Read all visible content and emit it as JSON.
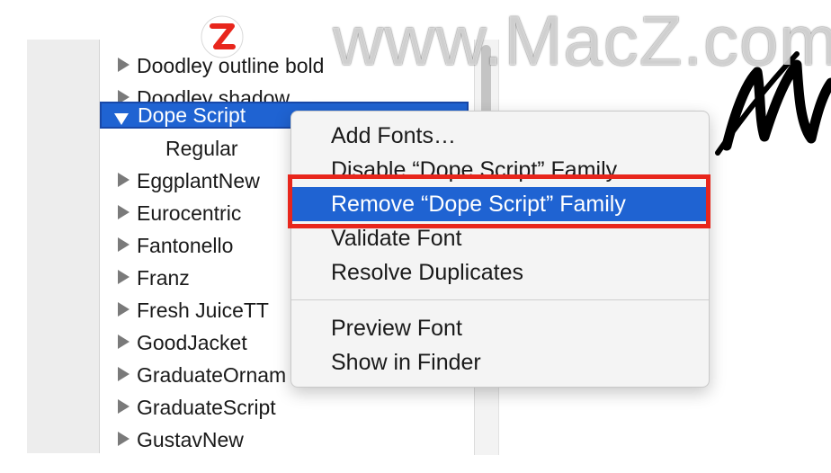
{
  "font_list": {
    "rows": [
      {
        "label": "Doodley outline bold",
        "type": "collapsed"
      },
      {
        "label": "Doodley shadow",
        "type": "collapsed"
      },
      {
        "label": "Dope Script",
        "type": "expanded-selected"
      },
      {
        "label": "Regular",
        "type": "child"
      },
      {
        "label": "EggplantNew",
        "type": "collapsed"
      },
      {
        "label": "Eurocentric",
        "type": "collapsed"
      },
      {
        "label": "Fantonello",
        "type": "collapsed"
      },
      {
        "label": "Franz",
        "type": "collapsed"
      },
      {
        "label": "Fresh JuiceTT",
        "type": "collapsed"
      },
      {
        "label": "GoodJacket",
        "type": "collapsed"
      },
      {
        "label": "GraduateOrnam",
        "type": "collapsed"
      },
      {
        "label": "GraduateScript",
        "type": "collapsed"
      },
      {
        "label": "GustavNew",
        "type": "collapsed"
      }
    ]
  },
  "context_menu": {
    "items": [
      {
        "label": "Add Fonts…"
      },
      {
        "label": "Disable “Dope Script” Family"
      },
      {
        "label": "Remove “Dope Script” Family",
        "highlighted": true
      },
      {
        "label": "Validate Font"
      },
      {
        "label": "Resolve Duplicates"
      },
      {
        "label": "Preview Font"
      },
      {
        "label": "Show in Finder"
      }
    ]
  },
  "watermark": {
    "text": "www.MacZ.com"
  },
  "colors": {
    "selection_blue": "#1f63d2",
    "annotation_red": "#e8261c",
    "menu_background": "#f4f4f4"
  }
}
